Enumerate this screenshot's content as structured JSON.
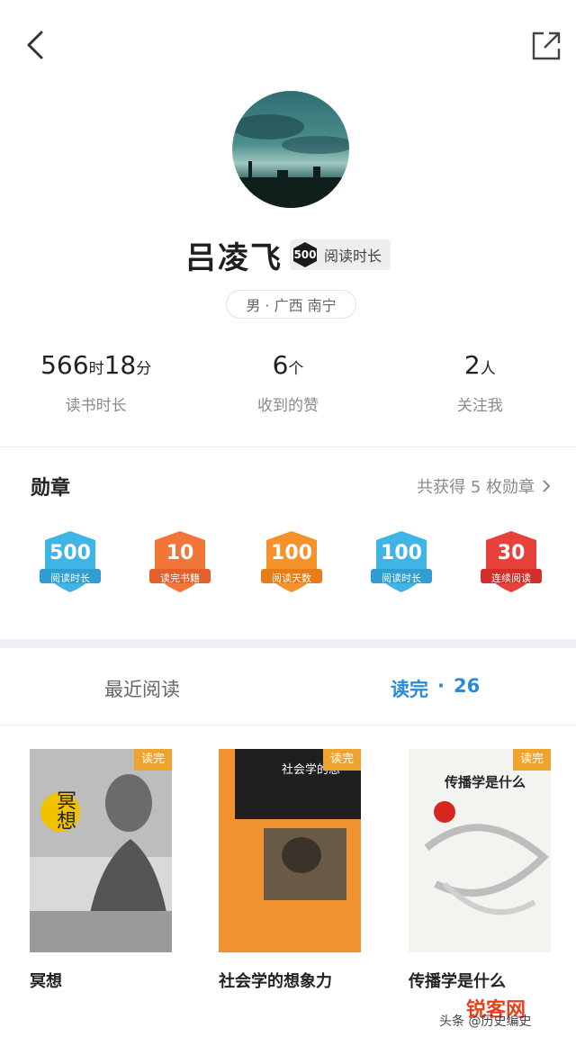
{
  "header": {
    "back_icon": "chevron-left-icon",
    "share_icon": "share-external-icon"
  },
  "profile": {
    "name": "吕凌飞",
    "level_number": "500",
    "level_label": "阅读时长",
    "location": "男 · 广西 南宁"
  },
  "stats": [
    {
      "value_a": "566",
      "unit_a": "时",
      "value_b": "18",
      "unit_b": "分",
      "label": "读书时长"
    },
    {
      "value_a": "6",
      "unit_a": "个",
      "value_b": "",
      "unit_b": "",
      "label": "收到的赞"
    },
    {
      "value_a": "2",
      "unit_a": "人",
      "value_b": "",
      "unit_b": "",
      "label": "关注我"
    }
  ],
  "medals": {
    "title": "勋章",
    "summary": "共获得 5 枚勋章",
    "items": [
      {
        "number": "500",
        "label": "阅读时长",
        "color": "#3fb4e6"
      },
      {
        "number": "10",
        "label": "读完书籍",
        "color": "#f2763a"
      },
      {
        "number": "100",
        "label": "阅读天数",
        "color": "#f5922a"
      },
      {
        "number": "100",
        "label": "阅读时长",
        "color": "#3fb4e6"
      },
      {
        "number": "30",
        "label": "连续阅读",
        "color": "#e8413b"
      }
    ]
  },
  "tabs": {
    "recent": "最近阅读",
    "done": "读完",
    "dot": "·",
    "done_count": "26"
  },
  "books": [
    {
      "title": "冥想",
      "tag": "读完",
      "cover_text": "冥想"
    },
    {
      "title": "社会学的想象力",
      "tag": "读完",
      "cover_text": "社会学的想"
    },
    {
      "title": "传播学是什么",
      "tag": "读完",
      "cover_text": "传播学是什么"
    }
  ],
  "watermark": {
    "logo": "锐客网",
    "text": "头条 @历史编史"
  },
  "colors": {
    "accent_blue": "#2a8bd8",
    "tag_orange": "#f0a430"
  }
}
